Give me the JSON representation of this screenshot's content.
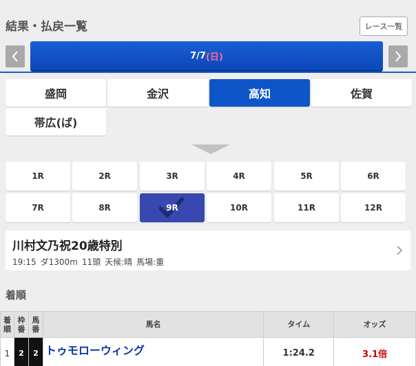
{
  "header": {
    "title": "結果・払戻一覧",
    "race_list_button": "レース一覧"
  },
  "date_nav": {
    "date": "7/7",
    "day_of_week": "(日)"
  },
  "venues": [
    {
      "label": "盛岡",
      "active": false
    },
    {
      "label": "金沢",
      "active": false
    },
    {
      "label": "高知",
      "active": true
    },
    {
      "label": "佐賀",
      "active": false
    },
    {
      "label": "帯広(ば)",
      "active": false
    }
  ],
  "races": [
    {
      "label": "1R",
      "active": false
    },
    {
      "label": "2R",
      "active": false
    },
    {
      "label": "3R",
      "active": false
    },
    {
      "label": "4R",
      "active": false
    },
    {
      "label": "5R",
      "active": false
    },
    {
      "label": "6R",
      "active": false
    },
    {
      "label": "7R",
      "active": false
    },
    {
      "label": "8R",
      "active": false
    },
    {
      "label": "9R",
      "active": true
    },
    {
      "label": "10R",
      "active": false
    },
    {
      "label": "11R",
      "active": false
    },
    {
      "label": "12R",
      "active": false
    }
  ],
  "race_info": {
    "name": "川村文乃祝20歳特別",
    "time": "19:15",
    "course": "ダ1300m",
    "runners": "11頭",
    "weather": "天候:晴",
    "track": "馬場:重"
  },
  "results_section": {
    "title": "着順"
  },
  "results_table": {
    "headers": {
      "rank": "着順",
      "waku": "枠番",
      "uma": "馬番",
      "name": "馬名",
      "time": "タイム",
      "odds": "オッズ"
    },
    "rows": [
      {
        "rank": "1",
        "waku": "2",
        "uma": "2",
        "name": "トゥモローウィング",
        "time": "1:24.2",
        "odds": "3.1倍"
      }
    ]
  },
  "colors": {
    "accent": "#0d55c8",
    "active_race": "#3749b0",
    "odds": "#cc0000",
    "horse_link": "#1133aa"
  }
}
